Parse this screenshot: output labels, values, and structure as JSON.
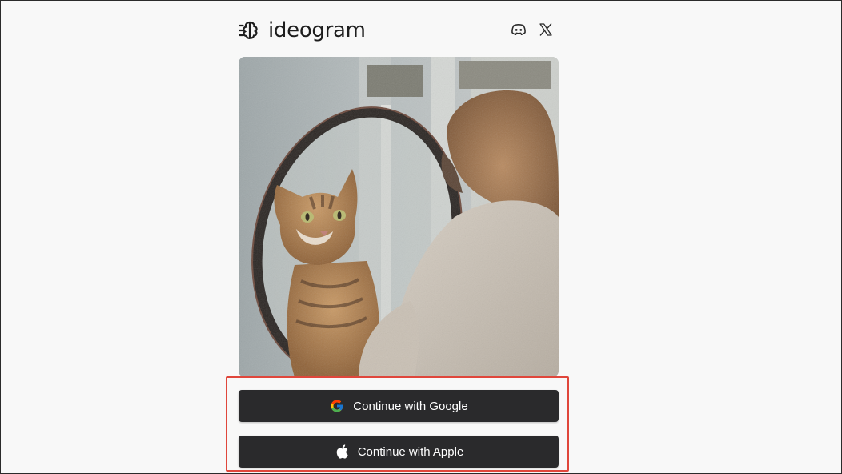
{
  "brand": {
    "name": "ideogram",
    "logo_icon": "ideogram-brain-logo"
  },
  "header": {
    "social": [
      {
        "icon": "discord-icon"
      },
      {
        "icon": "x-twitter-icon"
      }
    ]
  },
  "hero": {
    "subject": "cat-in-mirror-photo"
  },
  "auth": {
    "google_label": "Continue with Google",
    "google_icon": "google-g-icon",
    "apple_label": "Continue with Apple",
    "apple_icon": "apple-logo-icon"
  },
  "colors": {
    "button_bg": "#2a2a2c",
    "highlight_border": "#e0463b",
    "page_bg": "#f8f8f8"
  }
}
